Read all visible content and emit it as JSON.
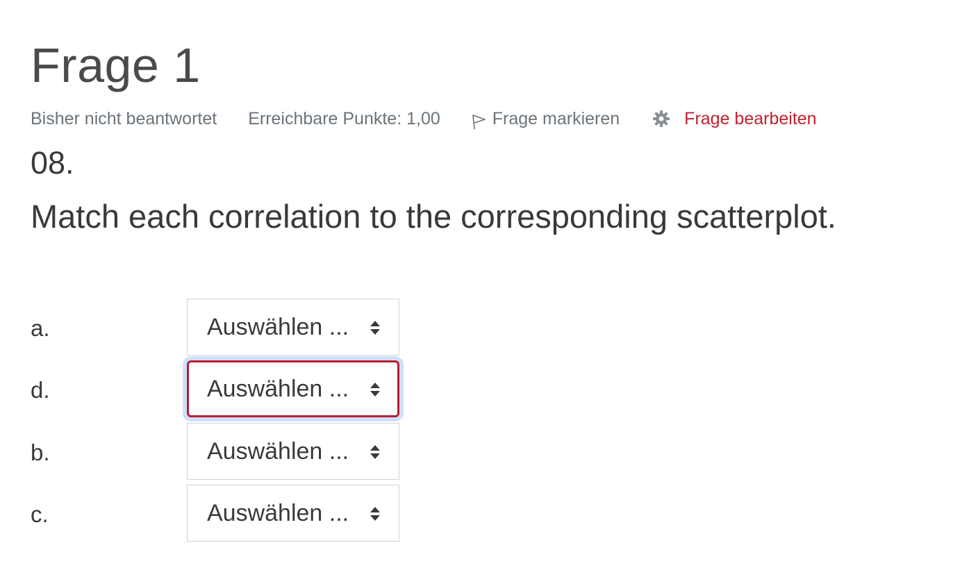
{
  "question": {
    "title": "Frage 1",
    "state": "Bisher nicht beantwortet",
    "grade": "Erreichbare Punkte: 1,00",
    "flag_label": "Frage markieren",
    "edit_label": "Frage bearbeiten",
    "number": "08.",
    "text": "Match each correlation to the corresponding scatterplot."
  },
  "matches": [
    {
      "label": "a.",
      "selected": "Auswählen ..."
    },
    {
      "label": "d.",
      "selected": "Auswählen ..."
    },
    {
      "label": "b.",
      "selected": "Auswählen ..."
    },
    {
      "label": "c.",
      "selected": "Auswählen ..."
    }
  ],
  "colors": {
    "edit_link": "#c2202f",
    "focus_border": "#b51e31",
    "focus_glow": "#cfe0fb",
    "muted_text": "#6a737b"
  },
  "icons": {
    "flag": "flag-icon",
    "edit": "gear-icon",
    "select": "sort-arrows-icon"
  }
}
